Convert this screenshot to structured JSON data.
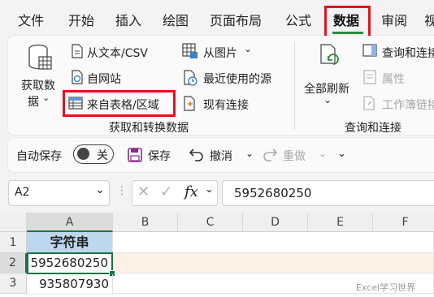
{
  "menu": {
    "tabs": [
      {
        "label": "文件"
      },
      {
        "label": "开始"
      },
      {
        "label": "插入"
      },
      {
        "label": "绘图"
      },
      {
        "label": "页面布局"
      },
      {
        "label": "公式"
      },
      {
        "label": "数据"
      },
      {
        "label": "审阅"
      },
      {
        "label": "视"
      }
    ],
    "active_tab": "数据"
  },
  "ribbon": {
    "get_data": {
      "label_line1": "获取数",
      "label_line2": "据"
    },
    "from_text_csv": "从文本/CSV",
    "from_web": "自网站",
    "from_table_range": "来自表格/区域",
    "from_picture": "从图片",
    "recent_sources": "最近使用的源",
    "existing_connections": "现有连接",
    "group_get_transform": "获取和转换数据",
    "refresh_all": {
      "label_line1": "全部刷新"
    },
    "queries_connections": "查询和连接",
    "properties": "属性",
    "edit_links": "工作簿链接",
    "group_queries": "查询和连接"
  },
  "qat": {
    "autosave_label": "自动保存",
    "autosave_state": "关",
    "save_label": "保存",
    "undo_label": "撤消",
    "redo_label": "重做"
  },
  "formula_bar": {
    "name_box": "A2",
    "fx_label": "fx",
    "value": "5952680250"
  },
  "sheet": {
    "columns": [
      "A",
      "B",
      "C",
      "D",
      "E",
      "F"
    ],
    "rows": [
      "1",
      "2",
      "3"
    ],
    "a1": "字符串",
    "a2": "5952680250",
    "a3": "935807930",
    "selected_cell": "A2"
  },
  "watermark": "Excel学习世界",
  "colors": {
    "accent_green": "#2e8b3c",
    "highlight_red": "#e0141e",
    "header_fill": "#bdd7ee",
    "selected_row": "#fdf1e6"
  }
}
